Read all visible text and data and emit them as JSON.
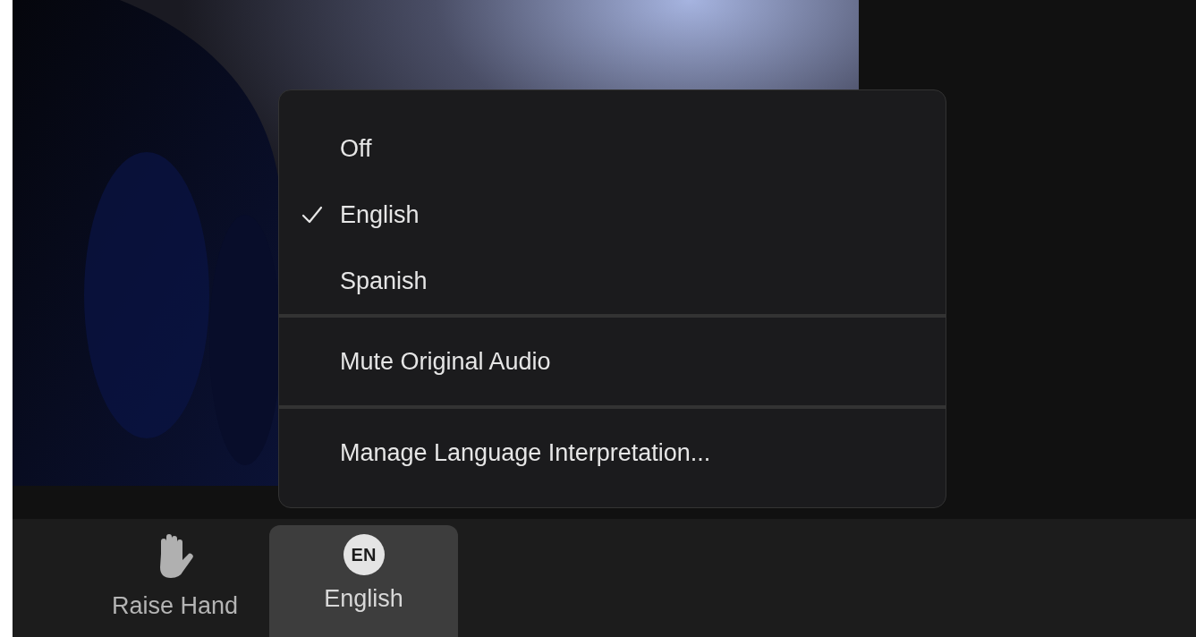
{
  "menu": {
    "sections": [
      [
        {
          "label": "Off",
          "checked": false
        },
        {
          "label": "English",
          "checked": true
        },
        {
          "label": "Spanish",
          "checked": false
        }
      ],
      [
        {
          "label": "Mute Original Audio",
          "checked": false
        }
      ],
      [
        {
          "label": "Manage Language Interpretation...",
          "checked": false
        }
      ]
    ]
  },
  "toolbar": [
    {
      "kind": "hand",
      "label": "Raise Hand",
      "selected": false
    },
    {
      "kind": "badge",
      "badge": "EN",
      "label": "English",
      "selected": true
    }
  ]
}
